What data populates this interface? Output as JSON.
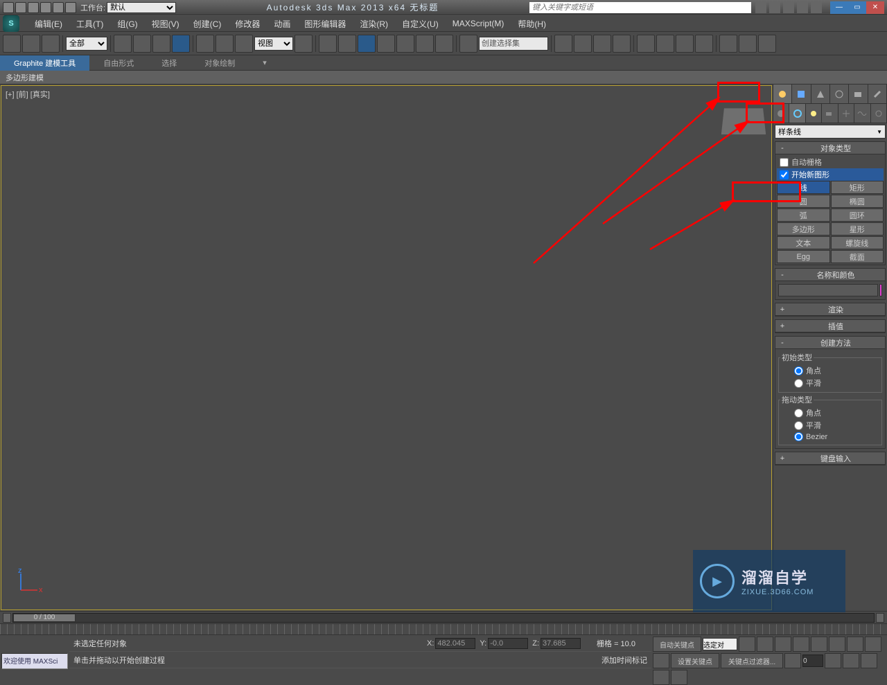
{
  "titlebar": {
    "workspace_label": "工作台:",
    "workspace_value": "默认",
    "app_title": "Autodesk 3ds Max  2013 x64    无标题",
    "search_placeholder": "键入关键字或短语"
  },
  "menu": {
    "edit": "编辑(E)",
    "tools": "工具(T)",
    "group": "组(G)",
    "views": "视图(V)",
    "create": "创建(C)",
    "modifiers": "修改器",
    "animation": "动画",
    "graph": "图形编辑器",
    "render": "渲染(R)",
    "custom": "自定义(U)",
    "maxscript": "MAXScript(M)",
    "help": "帮助(H)"
  },
  "maintoolbar": {
    "filter_all": "全部",
    "view_ref": "视图",
    "selset_prompt": "创建选择集"
  },
  "ribbon": {
    "graphite": "Graphite 建模工具",
    "freeform": "自由形式",
    "selection": "选择",
    "objpaint": "对象绘制",
    "sub": "多边形建模"
  },
  "viewport": {
    "label": "[+] [前] [真实]"
  },
  "cmdpanel": {
    "spline_cat": "样条线",
    "rollout_objtype": "对象类型",
    "autogrid": "自动栅格",
    "startnew": "开始新图形",
    "btn_line": "线",
    "btn_rect": "矩形",
    "btn_circle": "圆",
    "btn_ellipse": "椭圆",
    "btn_arc": "弧",
    "btn_donut": "圆环",
    "btn_ngon": "多边形",
    "btn_star": "星形",
    "btn_text": "文本",
    "btn_helix": "螺旋线",
    "btn_egg": "Egg",
    "btn_section": "截面",
    "rollout_name": "名称和颜色",
    "rollout_render": "渲染",
    "rollout_interp": "插值",
    "rollout_method": "创建方法",
    "group_init": "初始类型",
    "group_drag": "拖动类型",
    "radio_corner": "角点",
    "radio_smooth": "平滑",
    "radio_bezier": "Bezier",
    "rollout_keyboard": "键盘输入"
  },
  "timeline": {
    "frame": "0 / 100"
  },
  "status": {
    "welcome": "欢迎使用  MAXSci",
    "none_selected": "未选定任何对象",
    "prompt": "单击并拖动以开始创建过程",
    "x_label": "X:",
    "x_val": "482.045",
    "y_label": "Y:",
    "y_val": "-0.0",
    "z_label": "Z:",
    "z_val": "37.685",
    "grid": "栅格 = 10.0",
    "addtime": "添加时间标记",
    "autokey": "自动关键点",
    "setkey": "设置关键点",
    "keyfilter": "关键点过滤器...",
    "selected_locked": "选定对",
    "spinner_val": "0"
  },
  "watermark": {
    "title": "溜溜自学",
    "url": "ZIXUE.3D66.COM"
  }
}
